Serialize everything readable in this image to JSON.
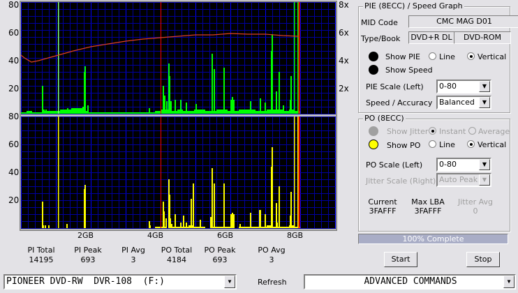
{
  "graph": {
    "left_ticks_top": [
      "80",
      "60",
      "40",
      "20"
    ],
    "left_ticks_bottom": [
      "80",
      "60",
      "40",
      "20"
    ],
    "right_ticks": [
      "8x",
      "6x",
      "4x",
      "2x"
    ],
    "x_ticks": [
      "2GB",
      "4GB",
      "6GB",
      "8GB"
    ],
    "colors": {
      "pie": "#00ff00",
      "po": "#ffff00",
      "speed": "#e04020",
      "grid": "#0000a0",
      "major_grid": "#0000ff",
      "marker": "#ff0000",
      "bg": "#000000"
    }
  },
  "chart_data": [
    {
      "type": "bar",
      "xlabel_ticks": [
        "2GB",
        "4GB",
        "6GB",
        "8GB"
      ],
      "xlim_gb": [
        0,
        9
      ],
      "ylim": [
        0,
        80
      ],
      "series_pie_spikes_gb_value": [
        [
          0.6,
          20
        ],
        [
          0.64,
          3
        ],
        [
          0.7,
          3
        ],
        [
          1.06,
          80
        ],
        [
          1.32,
          4
        ],
        [
          1.76,
          5
        ],
        [
          1.8,
          30
        ],
        [
          1.82,
          34
        ],
        [
          1.9,
          6
        ],
        [
          3.66,
          4
        ],
        [
          4.06,
          20
        ],
        [
          4.1,
          13
        ],
        [
          4.16,
          9
        ],
        [
          4.22,
          36
        ],
        [
          4.24,
          27
        ],
        [
          4.28,
          9
        ],
        [
          4.4,
          10
        ],
        [
          4.56,
          10
        ],
        [
          4.72,
          8
        ],
        [
          5.0,
          7
        ],
        [
          5.46,
          43
        ],
        [
          5.52,
          32
        ],
        [
          5.8,
          33
        ],
        [
          6.0,
          10
        ],
        [
          6.04,
          12
        ],
        [
          6.08,
          10
        ],
        [
          6.56,
          9
        ],
        [
          6.84,
          11
        ],
        [
          6.98,
          8
        ],
        [
          7.16,
          45
        ],
        [
          7.18,
          57
        ],
        [
          7.3,
          16
        ],
        [
          7.38,
          30
        ],
        [
          7.5,
          6
        ],
        [
          7.7,
          10
        ],
        [
          7.72,
          27
        ],
        [
          7.82,
          80
        ],
        [
          7.92,
          80
        ]
      ],
      "series_pie_baseline": [
        1,
        2,
        1,
        1,
        2,
        2,
        2,
        3,
        3,
        4,
        4,
        2,
        1,
        1,
        1,
        1,
        1,
        1,
        1,
        1,
        1,
        1,
        1,
        1,
        2,
        3,
        3,
        2,
        3,
        2,
        2,
        3,
        3,
        2,
        2,
        3,
        3,
        2,
        2,
        3,
        3,
        3,
        2,
        2,
        3,
        3,
        3,
        2,
        3,
        2
      ],
      "series_po_spikes_gb_value": [
        [
          0.6,
          19
        ],
        [
          0.62,
          2
        ],
        [
          0.68,
          2
        ],
        [
          0.78,
          2
        ],
        [
          1.06,
          80
        ],
        [
          1.3,
          3
        ],
        [
          1.8,
          28
        ],
        [
          1.82,
          31
        ],
        [
          3.66,
          5
        ],
        [
          3.68,
          2
        ],
        [
          4.06,
          19
        ],
        [
          4.08,
          12
        ],
        [
          4.14,
          7
        ],
        [
          4.22,
          35
        ],
        [
          4.24,
          24
        ],
        [
          4.26,
          7
        ],
        [
          4.3,
          3
        ],
        [
          4.4,
          10
        ],
        [
          4.56,
          4
        ],
        [
          4.64,
          9
        ],
        [
          4.72,
          4
        ],
        [
          4.86,
          21
        ],
        [
          4.92,
          32
        ],
        [
          5.12,
          6
        ],
        [
          5.42,
          8
        ],
        [
          5.46,
          43
        ],
        [
          5.52,
          32
        ],
        [
          5.8,
          32
        ],
        [
          6.0,
          10
        ],
        [
          6.04,
          11
        ],
        [
          6.08,
          10
        ],
        [
          6.26,
          3
        ],
        [
          6.56,
          11
        ],
        [
          6.82,
          13
        ],
        [
          6.84,
          13
        ],
        [
          6.98,
          10
        ],
        [
          7.16,
          44
        ],
        [
          7.18,
          58
        ],
        [
          7.3,
          18
        ],
        [
          7.32,
          4
        ],
        [
          7.38,
          30
        ],
        [
          7.7,
          9
        ],
        [
          7.72,
          26
        ],
        [
          7.82,
          80
        ],
        [
          7.92,
          80
        ]
      ],
      "series_po_baseline": [
        0,
        0,
        0,
        0,
        0,
        0,
        0,
        0,
        0,
        0,
        0,
        0,
        0,
        0,
        0,
        0,
        0,
        0,
        0,
        0,
        0,
        0,
        0,
        0,
        1,
        1,
        0,
        1,
        1,
        1,
        2,
        1,
        1,
        0,
        1,
        1,
        1,
        1,
        0,
        1,
        1,
        1,
        1,
        1,
        2,
        1,
        1,
        1,
        2,
        1
      ],
      "speed_gb_x": [
        [
          0,
          4.2
        ],
        [
          0.1,
          4.0
        ],
        [
          0.3,
          3.7
        ],
        [
          0.5,
          3.8
        ],
        [
          1.0,
          4.15
        ],
        [
          1.5,
          4.5
        ],
        [
          2.0,
          4.8
        ],
        [
          2.5,
          5.0
        ],
        [
          3.0,
          5.2
        ],
        [
          3.5,
          5.35
        ],
        [
          4.0,
          5.45
        ],
        [
          4.5,
          5.55
        ],
        [
          5.0,
          5.65
        ],
        [
          5.5,
          5.65
        ],
        [
          6.0,
          5.75
        ],
        [
          6.5,
          5.7
        ],
        [
          7.0,
          5.7
        ],
        [
          7.5,
          5.6
        ],
        [
          7.95,
          5.55
        ]
      ],
      "speed_ylim": [
        0,
        8
      ],
      "markers_gb": [
        4.0,
        7.96
      ]
    }
  ],
  "stats": [
    {
      "label": "PI Total",
      "value": "14195"
    },
    {
      "label": "PI Peak",
      "value": "693"
    },
    {
      "label": "PI Avg",
      "value": "3"
    },
    {
      "label": "PO Total",
      "value": "4184"
    },
    {
      "label": "PO Peak",
      "value": "693"
    },
    {
      "label": "PO Avg",
      "value": "3"
    }
  ],
  "pie_group": {
    "title": "PIE (8ECC) / Speed Graph",
    "mid_label": "MID Code",
    "mid_value": "CMC MAG D01",
    "type_label": "Type/Book",
    "type_value": "DVD+R DL",
    "book_value": "DVD-ROM",
    "show_pie": "Show PIE",
    "line": "Line",
    "vertical": "Vertical",
    "show_speed": "Show Speed",
    "scale_label": "PIE Scale (Left)",
    "scale_value": "0-80",
    "accuracy_label": "Speed / Accuracy",
    "accuracy_value": "Balanced"
  },
  "po_group": {
    "title": "PO (8ECC)",
    "show_jitter": "Show Jitter",
    "instant": "Instant",
    "average": "Average",
    "show_po": "Show PO",
    "line": "Line",
    "vertical": "Vertical",
    "scale_label": "PO Scale (Left)",
    "scale_value": "0-80",
    "jitter_scale_label": "Jitter Scale (Right)",
    "jitter_scale_value": "Auto Peak",
    "current_label": "Current",
    "current_value": "3FAFFF",
    "maxlba_label": "Max LBA",
    "maxlba_value": "3FAFFF",
    "jitteravg_label": "Jitter Avg",
    "jitteravg_value": "0"
  },
  "progress": {
    "text": "100% Complete",
    "percent": 100
  },
  "buttons": {
    "start": "Start",
    "stop": "Stop",
    "refresh": "Refresh"
  },
  "drive": {
    "value": "PIONEER DVD-RW  DVR-108  (F:)"
  },
  "advanced": {
    "value": "ADVANCED COMMANDS"
  }
}
